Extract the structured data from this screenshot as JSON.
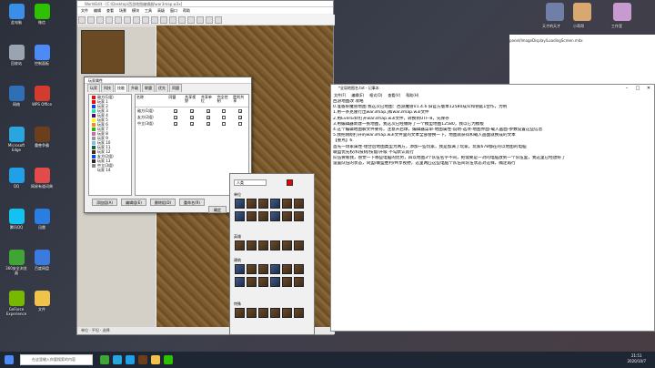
{
  "desktop_icons": [
    {
      "label": "此电脑",
      "color": "#3a8ee6"
    },
    {
      "label": "回收站",
      "color": "#9aa4b1"
    },
    {
      "label": "网络",
      "color": "#2f6fb6"
    },
    {
      "label": "Microsoft Edge",
      "color": "#2aa6de"
    },
    {
      "label": "QQ",
      "color": "#21a0e8"
    },
    {
      "label": "腾讯QQ",
      "color": "#14c2f2"
    },
    {
      "label": "360安全浏览器",
      "color": "#3fa535"
    },
    {
      "label": "GeForce Experience",
      "color": "#76b900"
    },
    {
      "label": "微信",
      "color": "#2dc100"
    },
    {
      "label": "控制面板",
      "color": "#4c8bf5"
    },
    {
      "label": "WPS Office",
      "color": "#d33b2c"
    },
    {
      "label": "魔兽争霸",
      "color": "#6b3f1c"
    },
    {
      "label": "网易有道词典",
      "color": "#e24b4b"
    },
    {
      "label": "迅雷",
      "color": "#2a7de1"
    },
    {
      "label": "百度网盘",
      "color": "#3b7be0"
    },
    {
      "label": "文件",
      "color": "#f1c24b"
    }
  ],
  "avatars": [
    {
      "label": "天才的天才",
      "color": "#6f7fa8"
    },
    {
      "label": "小哥哥",
      "color": "#d8a870"
    },
    {
      "label": "工作室",
      "color": "#c79bd0"
    }
  ],
  "worldedit": {
    "title": "WorldEdit - [C:\\Desktop\\西游地图编辑器\\war3map.w3x]",
    "menu": [
      "文件",
      "编辑",
      "查看",
      "场景",
      "模块",
      "工具",
      "高级",
      "窗口",
      "帮助"
    ],
    "status": "单位 · 平坦 · 选择"
  },
  "player_dialog": {
    "title": "玩家属性",
    "tabs": [
      "玩家",
      "科技",
      "技能",
      "升级",
      "联盟",
      "优先",
      "同盟"
    ],
    "tree": [
      {
        "label": "敌方(1组)",
        "color": "#ff0303"
      },
      {
        "label": "玩家 1",
        "color": "#ff0303"
      },
      {
        "label": "玩家 2",
        "color": "#0042ff"
      },
      {
        "label": "玩家 3",
        "color": "#1ce6b9"
      },
      {
        "label": "玩家 4",
        "color": "#540081"
      },
      {
        "label": "玩家 5",
        "color": "#fffc01"
      },
      {
        "label": "玩家 6",
        "color": "#fe8a0e"
      },
      {
        "label": "玩家 7",
        "color": "#20c000"
      },
      {
        "label": "玩家 8",
        "color": "#e55bb0"
      },
      {
        "label": "玩家 9",
        "color": "#959697"
      },
      {
        "label": "玩家 10",
        "color": "#7ebff1"
      },
      {
        "label": "玩家 11",
        "color": "#106246"
      },
      {
        "label": "玩家 12",
        "color": "#4e2a04"
      },
      {
        "label": "友方(2组)",
        "color": "#0042ff"
      },
      {
        "label": "玩家 13",
        "color": "#282828"
      },
      {
        "label": "中立(3组)",
        "color": "#888888"
      },
      {
        "label": "玩家 14",
        "color": "#ffffff"
      }
    ],
    "columns": [
      "名称",
      "同盟",
      "共享视野",
      "共享单位",
      "完全控制",
      "胜利共享"
    ],
    "rows": [
      {
        "name": "敌方(1组)",
        "checks": [
          true,
          true,
          true,
          false,
          true
        ]
      },
      {
        "name": "友方(2组)",
        "checks": [
          true,
          true,
          true,
          false,
          true
        ]
      },
      {
        "name": "中立(3组)",
        "checks": [
          true,
          true,
          true,
          false,
          false
        ]
      }
    ],
    "buttons": {
      "add": "添加组(A)",
      "edit": "编辑组(E)",
      "delete": "删除组(D)",
      "rename": "重命名(R)",
      "ok": "确定",
      "cancel": "取消"
    }
  },
  "palette": {
    "labels": [
      "单位",
      "英雄",
      "建筑",
      "特殊"
    ],
    "select_value": "人类",
    "tiles": 30
  },
  "web": {
    "path": "panel/ImageDisplay/LoadingScreen.mdx"
  },
  "notepad": {
    "title": "*全局地图名.txt - 记事本",
    "menu": [
      "文件(F)",
      "编辑(E)",
      "格式(O)",
      "查看(V)",
      "帮助(H)"
    ],
    "lines": [
      "西游地图改 攻略",
      "0.准备好魔兽地图 我这次已地图：西游魔兽V1.4.6 旧官方版本12580成众和钥匙1合作，为例",
      "1.用一条克隆行出war3map.j和war3map.w3i文件",
      "2.用EverEdit打开war3map.w3i文件，转换到UTF-8，先保存",
      "3.用编辑器新建一张地图，我这次已经做好了一个模型地图12580，我以它为模板",
      "4.这个编辑地图解文件要有，注意开启球，编辑器菜单-地图属性-说明-选项-地图界面-载入画面-参数设置这些信息",
      "5.我把刚刚打开的war3map.w3i文件里的文本全部替换一下，地图就获得和载入画面就换成的文本",
      "【重点】6.",
      "首先一场家属性-组合后地图类型为两方，添加一些玩家，我是加满了玩家，玩家678都在的以地图的电脑",
      "联盟优先权/科技树/技能/升级 不勾默认就行",
      "队伍要看我，感觉一下哪些电脑的优势，四以地图3个队伍名字不同，把需要是一对的电脑放到一个队伍里，我这里已经放好了",
      "设置队伍的状态，同盟/联盟胜利/共享视野，这里两匹这些电脑个队伍间队伍状态对这样，确定再行"
    ]
  },
  "taskbar": {
    "search_placeholder": "在这里输入你要搜索的内容",
    "time": "21:51",
    "date": "2020/10/7"
  }
}
